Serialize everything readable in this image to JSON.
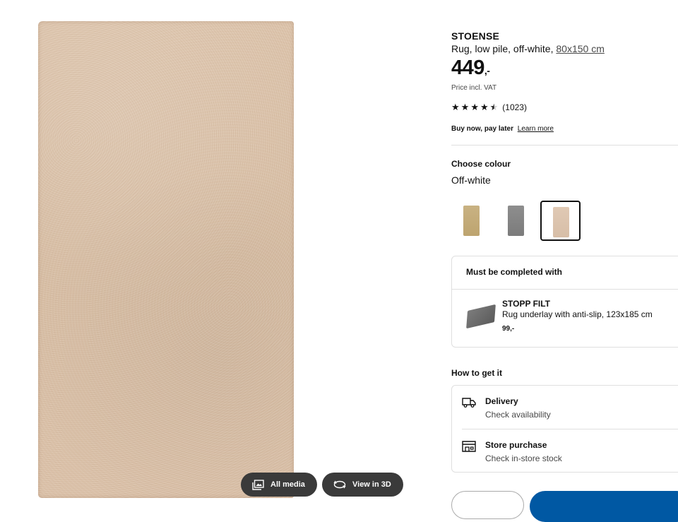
{
  "gallery": {
    "all_media_label": "All media",
    "view_3d_label": "View in 3D"
  },
  "product": {
    "name": "STOENSE",
    "description": "Rug, low pile, off-white,",
    "size_link": "80x150 cm",
    "price_main": "449",
    "price_decimal": ",-",
    "vat_note": "Price incl. VAT",
    "rating_stars": 4.5,
    "rating_count": "(1023)",
    "bnpl_text": "Buy now, pay later",
    "bnpl_link": "Learn more"
  },
  "colour": {
    "heading": "Choose colour",
    "selected": "Off-white",
    "swatches": [
      {
        "name": "beige",
        "color": "#c4ab7a"
      },
      {
        "name": "grey",
        "color": "#858585"
      },
      {
        "name": "off-white",
        "color": "#dcc4ae",
        "selected": true
      }
    ]
  },
  "accessory": {
    "heading": "Must be completed with",
    "name": "STOPP FILT",
    "description": "Rug underlay with anti-slip, 123x185 cm",
    "price": "99,-"
  },
  "fulfilment": {
    "heading": "How to get it",
    "delivery_title": "Delivery",
    "delivery_sub": "Check availability",
    "store_title": "Store purchase",
    "store_sub": "Check in-store stock"
  },
  "colors": {
    "primary_button": "#0058a3",
    "gallery_button": "#3a3a3a"
  }
}
